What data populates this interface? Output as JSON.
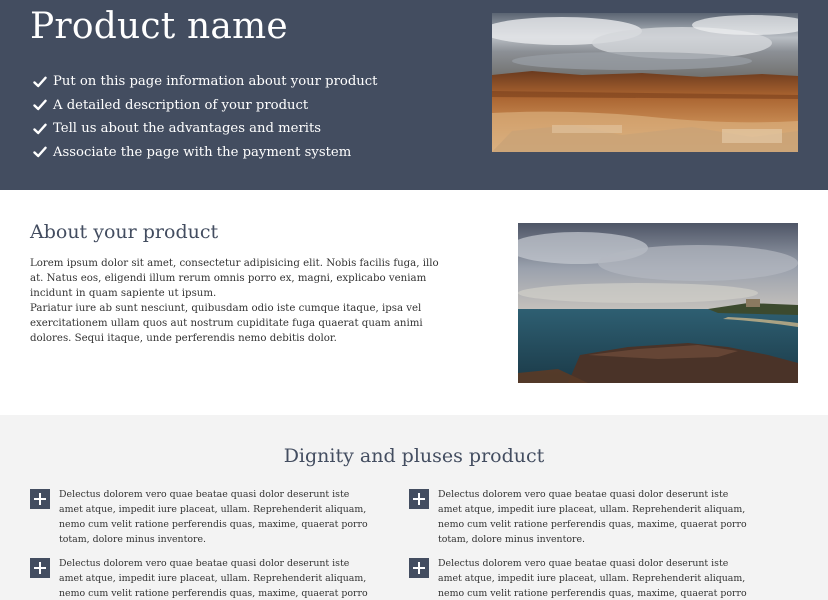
{
  "hero": {
    "title": "Product name",
    "items": [
      "Put on this page information about your product",
      "A detailed description of your product",
      "Tell us about the advantages and merits",
      "Associate the page with the payment system"
    ],
    "image_icon": "desert-landscape-photo",
    "background_color": "#434d60"
  },
  "about": {
    "title": "About your product",
    "paragraphs": [
      "Lorem ipsum dolor sit amet, consectetur adipisicing elit. Nobis facilis fuga, illo at. Natus eos, eligendi illum rerum omnis porro ex, magni, explicabo veniam incidunt in quam sapiente ut ipsum.",
      "Pariatur iure ab sunt nesciunt, quibusdam odio iste cumque itaque, ipsa vel exercitationem ullam quos aut nostrum cupiditate fuga quaerat quam animi dolores. Sequi itaque, unde perferendis nemo debitis dolor."
    ],
    "image_icon": "seaside-cliff-photo"
  },
  "dignity": {
    "title": "Dignity and pluses product",
    "features": [
      "Delectus dolorem vero quae beatae quasi dolor deserunt iste amet atque, impedit iure placeat, ullam. Reprehenderit aliquam, nemo cum velit ratione perferendis quas, maxime, quaerat porro totam, dolore minus inventore.",
      "Delectus dolorem vero quae beatae quasi dolor deserunt iste amet atque, impedit iure placeat, ullam. Reprehenderit aliquam, nemo cum velit ratione perferendis quas, maxime, quaerat porro totam, dolore minus inventore.",
      "Delectus dolorem vero quae beatae quasi dolor deserunt iste amet atque, impedit iure placeat, ullam. Reprehenderit aliquam, nemo cum velit ratione perferendis quas, maxime, quaerat porro totam, dolore minus inventore.",
      "Delectus dolorem vero quae beatae quasi dolor deserunt iste amet atque, impedit iure placeat, ullam. Reprehenderit aliquam, nemo cum velit ratione perferendis quas, maxime, quaerat porro totam, dolore minus inventore."
    ],
    "feature_icon": "plus-icon",
    "background_color": "#f3f3f3"
  }
}
